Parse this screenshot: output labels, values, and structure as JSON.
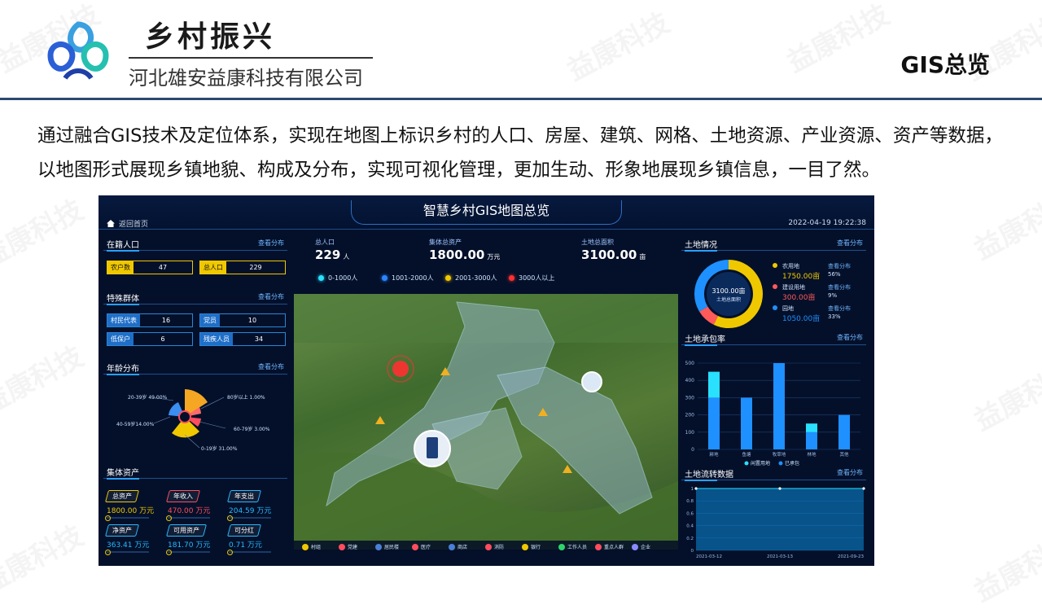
{
  "header": {
    "brand": "乡村振兴",
    "company": "河北雄安益康科技有限公司",
    "slide_title": "GIS总览",
    "watermark": "益康科技"
  },
  "description": "通过融合GIS技术及定位体系，实现在地图上标识乡村的人口、房屋、建筑、网格、土地资源、产业资源、资产等数据，以地图形式展现乡镇地貌、构成及分布，实现可视化管理，更加生动、形象地展现乡镇信息，一目了然。",
  "dashboard": {
    "title": "智慧乡村GIS地图总览",
    "home_label": "返回首页",
    "datetime": "2022-04-19 19:22:38",
    "more_label": "查看分布",
    "left": {
      "population": {
        "title": "在籍人口",
        "items": [
          {
            "label": "农户数",
            "value": "47"
          },
          {
            "label": "总人口",
            "value": "229"
          }
        ]
      },
      "special": {
        "title": "特殊群体",
        "items": [
          {
            "label": "村民代表",
            "value": "16"
          },
          {
            "label": "党员",
            "value": "10"
          },
          {
            "label": "低保户",
            "value": "6"
          },
          {
            "label": "残疾人员",
            "value": "34"
          }
        ]
      },
      "age": {
        "title": "年龄分布",
        "labels": [
          "20-39岁 49.00%",
          "80岁以上 1.00%",
          "40-59岁14.00%",
          "60-79岁 3.00%",
          "0-19岁 31.00%"
        ]
      },
      "assets": {
        "title": "集体资产",
        "items": [
          {
            "label": "总资产",
            "value": "1800.00 万元",
            "color": "#f0c800"
          },
          {
            "label": "年收入",
            "value": "470.00 万元",
            "color": "#ff4d5e"
          },
          {
            "label": "年支出",
            "value": "204.59 万元",
            "color": "#29b8ff"
          },
          {
            "label": "净资产",
            "value": "363.41 万元",
            "color": "#29b8ff"
          },
          {
            "label": "可用资产",
            "value": "181.70 万元",
            "color": "#29b8ff"
          },
          {
            "label": "可分红",
            "value": "0.71 万元",
            "color": "#29b8ff"
          }
        ]
      }
    },
    "center": {
      "kpis": [
        {
          "label": "总人口",
          "value": "229",
          "unit": "人"
        },
        {
          "label": "集体总资产",
          "value": "1800.00",
          "unit": "万元"
        },
        {
          "label": "土地总面积",
          "value": "3100.00",
          "unit": "亩"
        }
      ],
      "legend": [
        {
          "label": "0-1000人",
          "color": "#29e0ff"
        },
        {
          "label": "1001-2000人",
          "color": "#2a86ff"
        },
        {
          "label": "2001-3000人",
          "color": "#f0c800"
        },
        {
          "label": "3000人以上",
          "color": "#ff3030"
        }
      ],
      "toolbar": [
        {
          "label": "村组",
          "color": "#f0c800"
        },
        {
          "label": "党建",
          "color": "#ff4d5e"
        },
        {
          "label": "居民楼",
          "color": "#4a7fd6"
        },
        {
          "label": "医疗",
          "color": "#ff4d5e"
        },
        {
          "label": "商店",
          "color": "#4a7fd6"
        },
        {
          "label": "消防",
          "color": "#ff4d5e"
        },
        {
          "label": "银行",
          "color": "#f0c800"
        },
        {
          "label": "工作人员",
          "color": "#2ed46a"
        },
        {
          "label": "重点人群",
          "color": "#ff4d5e"
        },
        {
          "label": "企业",
          "color": "#8a8aff"
        }
      ]
    },
    "right": {
      "land": {
        "title": "土地情况",
        "center_value": "3100.00亩",
        "center_label": "土地总面积",
        "items": [
          {
            "label": "农用地",
            "value": "1750.00亩",
            "pct": "56%",
            "color": "#f0c800"
          },
          {
            "label": "建设用地",
            "value": "300.00亩",
            "pct": "9%",
            "color": "#ff5a5a"
          },
          {
            "label": "园地",
            "value": "1050.00亩",
            "pct": "33%",
            "color": "#1e90ff"
          }
        ]
      },
      "contract": {
        "title": "土地承包率",
        "legend": [
          "闲置用地",
          "已承包"
        ]
      },
      "transfer": {
        "title": "土地流转数据"
      }
    }
  },
  "chart_data": [
    {
      "type": "bar",
      "title": "土地承包率",
      "categories": [
        "耕地",
        "鱼塘",
        "牧草地",
        "林地",
        "其他"
      ],
      "series": [
        {
          "name": "闲置用地",
          "values": [
            150,
            0,
            0,
            50,
            0
          ]
        },
        {
          "name": "已承包",
          "values": [
            300,
            300,
            500,
            100,
            200
          ]
        }
      ],
      "ylim": [
        0,
        500
      ],
      "yticks": [
        0,
        100,
        200,
        300,
        400,
        500
      ],
      "stacked": true,
      "grid": true
    },
    {
      "type": "line",
      "title": "土地流转数据",
      "x": [
        "2021-03-12",
        "2021-03-13",
        "2021-09-23"
      ],
      "values": [
        1,
        1,
        1
      ],
      "ylim": [
        0,
        1
      ],
      "yticks": [
        0,
        0.2,
        0.4,
        0.6,
        0.8,
        1
      ],
      "grid": true
    }
  ]
}
